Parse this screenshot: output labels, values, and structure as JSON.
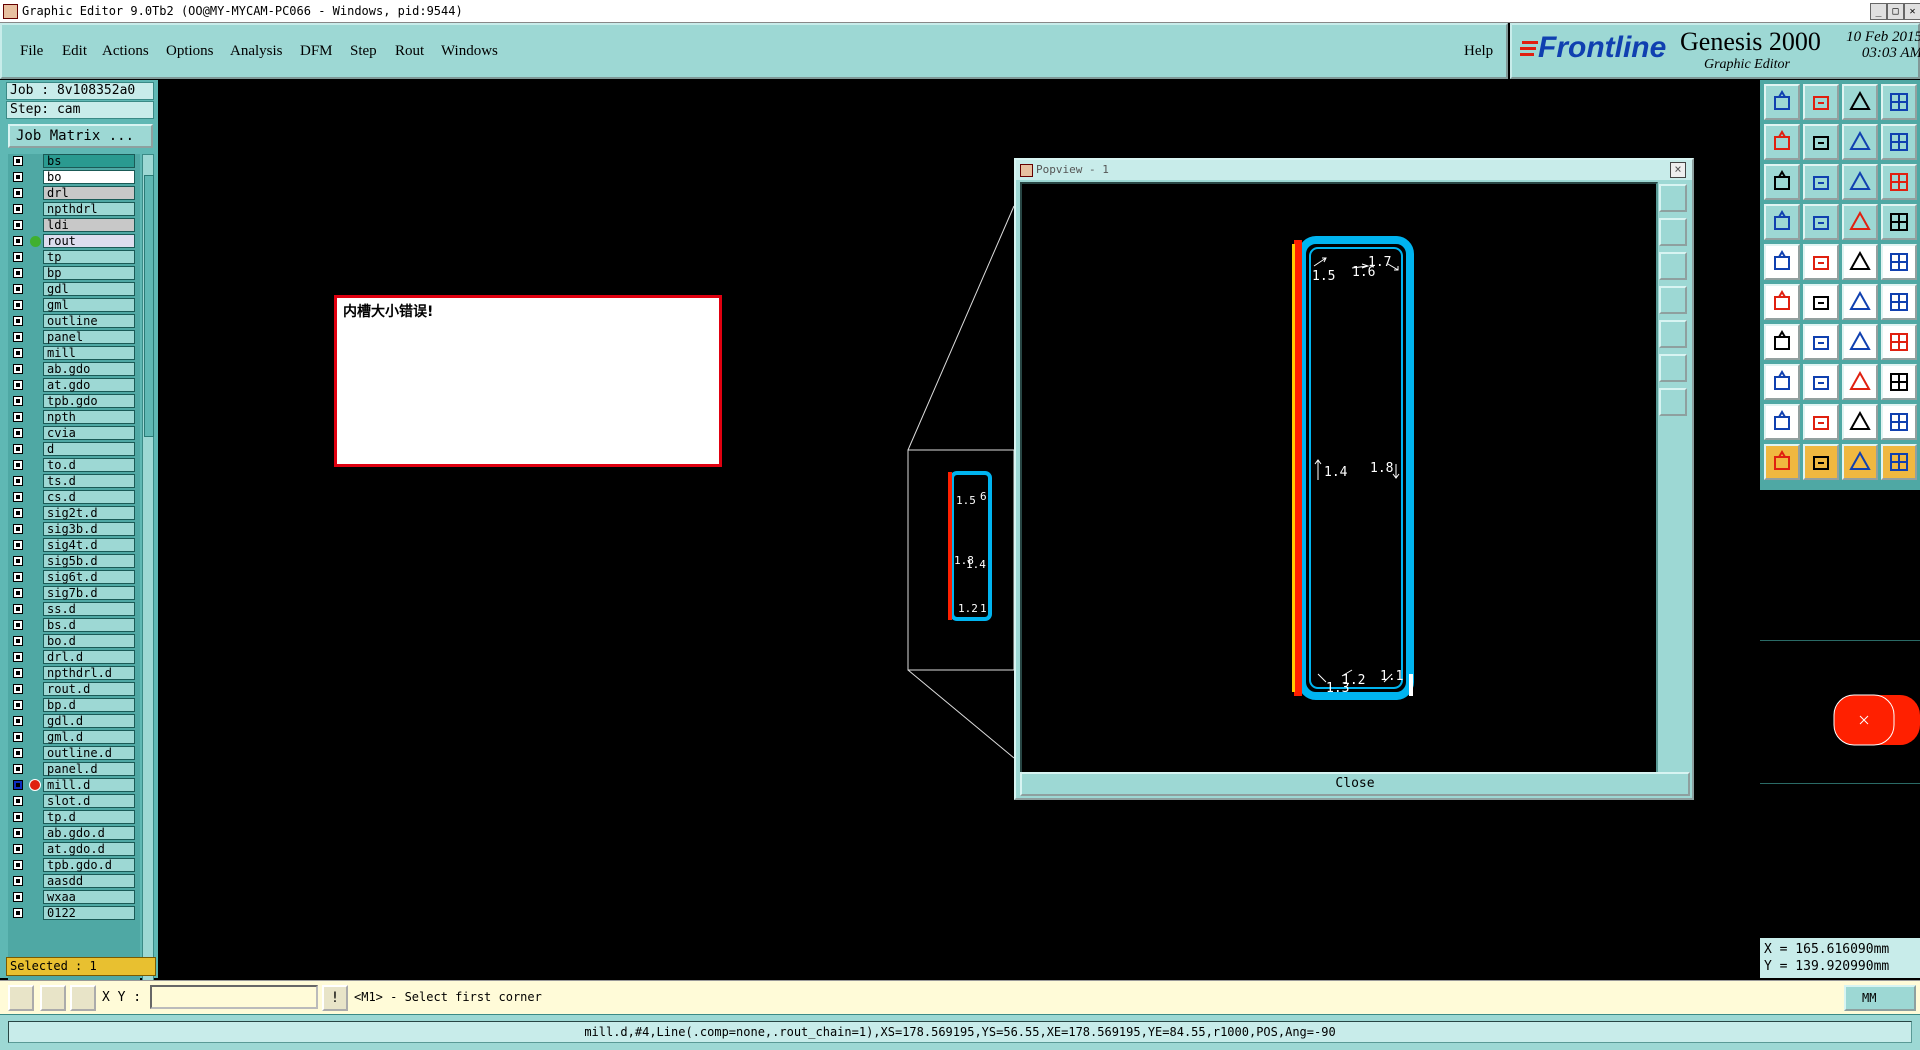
{
  "window": {
    "title": "Graphic Editor 9.0Tb2 (OO@MY-MYCAM-PC066 - Windows, pid:9544)"
  },
  "menu": {
    "items": [
      "File",
      "Edit",
      "Actions",
      "Options",
      "Analysis",
      "DFM",
      "Step",
      "Rout",
      "Windows"
    ],
    "help": "Help"
  },
  "brand": {
    "logo": "Frontline",
    "product": "Genesis 2000",
    "subtitle": "Graphic Editor",
    "date": "10 Feb 2015",
    "time": "03:03 AM"
  },
  "job": {
    "job_label": "Job : 8v108352a0",
    "step_label": "Step: cam",
    "job_matrix_button": "Job Matrix ..."
  },
  "layers": [
    {
      "name": "bs",
      "style": "sel"
    },
    {
      "name": "bo",
      "style": "white"
    },
    {
      "name": "drl",
      "style": "gray"
    },
    {
      "name": "npthdrl",
      "style": "normal"
    },
    {
      "name": "ldi",
      "style": "gray"
    },
    {
      "name": "rout",
      "style": "light"
    },
    {
      "name": "tp",
      "style": "normal"
    },
    {
      "name": "bp",
      "style": "normal"
    },
    {
      "name": "gdl",
      "style": "normal"
    },
    {
      "name": "gml",
      "style": "normal"
    },
    {
      "name": "outline",
      "style": "normal"
    },
    {
      "name": "panel",
      "style": "normal"
    },
    {
      "name": "mill",
      "style": "normal"
    },
    {
      "name": "ab.gdo",
      "style": "normal"
    },
    {
      "name": "at.gdo",
      "style": "normal"
    },
    {
      "name": "tpb.gdo",
      "style": "normal"
    },
    {
      "name": "npth",
      "style": "normal"
    },
    {
      "name": "cvia",
      "style": "normal"
    },
    {
      "name": "d",
      "style": "normal"
    },
    {
      "name": "to.d",
      "style": "normal"
    },
    {
      "name": "ts.d",
      "style": "normal"
    },
    {
      "name": "cs.d",
      "style": "normal"
    },
    {
      "name": "sig2t.d",
      "style": "normal"
    },
    {
      "name": "sig3b.d",
      "style": "normal"
    },
    {
      "name": "sig4t.d",
      "style": "normal"
    },
    {
      "name": "sig5b.d",
      "style": "normal"
    },
    {
      "name": "sig6t.d",
      "style": "normal"
    },
    {
      "name": "sig7b.d",
      "style": "normal"
    },
    {
      "name": "ss.d",
      "style": "normal"
    },
    {
      "name": "bs.d",
      "style": "normal"
    },
    {
      "name": "bo.d",
      "style": "normal"
    },
    {
      "name": "drl.d",
      "style": "normal"
    },
    {
      "name": "npthdrl.d",
      "style": "normal"
    },
    {
      "name": "rout.d",
      "style": "normal"
    },
    {
      "name": "bp.d",
      "style": "normal"
    },
    {
      "name": "gdl.d",
      "style": "normal"
    },
    {
      "name": "gml.d",
      "style": "normal"
    },
    {
      "name": "outline.d",
      "style": "normal"
    },
    {
      "name": "panel.d",
      "style": "normal"
    },
    {
      "name": "mill.d",
      "style": "active"
    },
    {
      "name": "slot.d",
      "style": "normal"
    },
    {
      "name": "tp.d",
      "style": "normal"
    },
    {
      "name": "ab.gdo.d",
      "style": "normal"
    },
    {
      "name": "at.gdo.d",
      "style": "normal"
    },
    {
      "name": "tpb.gdo.d",
      "style": "normal"
    },
    {
      "name": "aasdd",
      "style": "normal"
    },
    {
      "name": "wxaa",
      "style": "normal"
    },
    {
      "name": "0122",
      "style": "normal"
    }
  ],
  "selected_label": "Selected : 1",
  "message_box": {
    "text": "内槽大小错误!"
  },
  "popview": {
    "title": "Popview - 1",
    "close_label": "Close",
    "labels": [
      "1.5",
      "1.6",
      "1.7",
      "1.4",
      "1.8",
      "1.3",
      "1.2",
      "1.1"
    ]
  },
  "mini_labels": [
    "1.5",
    "6",
    "1.8",
    "1.4",
    "1.2",
    "1"
  ],
  "coords": {
    "x": "X = 165.616090mm",
    "y": "Y = 139.920990mm"
  },
  "command": {
    "xy_label": "X Y :",
    "xy_value": "",
    "prompt": "<M1> - Select first corner",
    "unit": "MM"
  },
  "status": "mill.d,#4,Line(.comp=none,.rout_chain=1),XS=178.569195,YS=56.55,XE=178.569195,YE=84.55,r1000,POS,Ang=-90",
  "colors": {
    "panel": "#9dd8d4",
    "profile": "#00b4f0",
    "rout": "#ff2000",
    "highlight": "#ffffff"
  },
  "toolbar_icons": [
    "zoom-home-icon",
    "zoom-out-icon",
    "zoom-fit-icon",
    "grid-icon",
    "pan-left-icon",
    "pan-right-icon",
    "mirror-icon",
    "panel-icon",
    "fit-icon",
    "center-icon",
    "scale-1-2-icon",
    "help-icon",
    "measure-icon",
    "snap-icon",
    "layers-icon",
    "layers-alt-icon",
    "pad-icon",
    "add-line-icon",
    "dash-icon",
    "circle-icon",
    "move-icon",
    "cross-icon",
    "connect-icon",
    "node-icon",
    "angle-icon",
    "slash-icon",
    "arc-icon",
    "split-icon",
    "reshape-icon",
    "minus-icon",
    "resize-icon",
    "group-icon",
    "triangle-icon",
    "vertex-icon",
    "arc-edit-icon",
    "arc-alt-icon",
    "pointer-icon",
    "select-icon",
    "cursor-icon",
    "route-icon"
  ]
}
